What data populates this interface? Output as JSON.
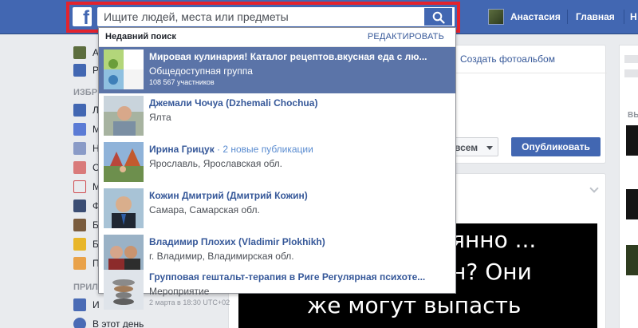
{
  "topbar": {
    "logo": "f",
    "search_placeholder": "Ищите людей, места или предметы",
    "user_name": "Анастасия",
    "home_label": "Главная",
    "more_label": "Н"
  },
  "sidebar": {
    "section_favorites": "ИЗБР",
    "section_apps": "ПРИЛ",
    "items": [
      {
        "label": "А"
      },
      {
        "label": "Р"
      },
      {
        "label": "Л"
      },
      {
        "label": "М"
      },
      {
        "label": "Н"
      },
      {
        "label": "С"
      },
      {
        "label": "М"
      },
      {
        "label": "Ф"
      },
      {
        "label": "Б"
      },
      {
        "label": "Б"
      },
      {
        "label": "П"
      },
      {
        "label": "И"
      },
      {
        "label": "В этот день"
      }
    ]
  },
  "composer": {
    "album_link": "Создать фотоальбом",
    "audience_label": "всем",
    "publish_label": "Опубликовать"
  },
  "post": {
    "image_lines": [
      "оянно ...",
      "ан? Они",
      "же могут выпасть"
    ]
  },
  "right": {
    "label": "ВЫ"
  },
  "dropdown": {
    "header": "Недавний поиск",
    "edit_label": "РЕДАКТИРОВАТЬ",
    "items": [
      {
        "title": "Мировая кулинария! Каталог рецептов.вкусная еда с лю...",
        "subtitle": "Общедоступная группа",
        "meta": "108 567 участников"
      },
      {
        "title": "Джемали Чочуа (Dzhemali Chochua)",
        "subtitle": "Ялта",
        "meta": ""
      },
      {
        "title": "Ирина Грицук",
        "badge": "· 2 новые публикации",
        "subtitle": "Ярославль, Ярославская обл.",
        "meta": ""
      },
      {
        "title": "Кожин Дмитрий (Дмитрий Кожин)",
        "subtitle": "Самара, Самарская обл.",
        "meta": ""
      },
      {
        "title": "Владимир Плохих (Vladimir Plokhikh)",
        "subtitle": "г. Владимир, Владимирская обл.",
        "meta": ""
      },
      {
        "title": "Групповая гештальт-терапия в Риге Регулярная психоте...",
        "subtitle": "Мероприятие",
        "meta": "2 марта в 18:30 UTC+02"
      }
    ]
  }
}
